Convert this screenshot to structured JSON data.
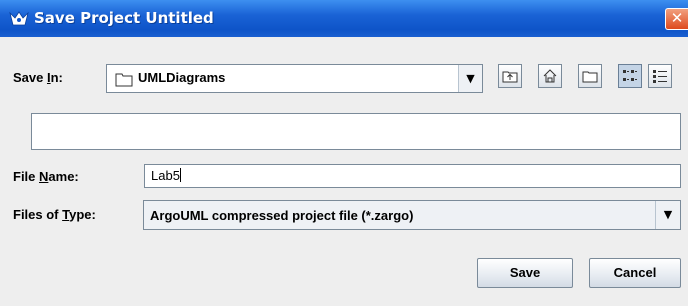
{
  "window": {
    "title": "Save Project Untitled",
    "close_glyph": "✕"
  },
  "save_in": {
    "label_pre": "Save ",
    "label_key": "I",
    "label_post": "n:",
    "value": "UMLDiagrams",
    "icon": "folder-icon"
  },
  "toolbar": {
    "buttons": [
      {
        "name": "up-one-level-button",
        "icon": "up-folder-icon"
      },
      {
        "name": "home-button",
        "icon": "home-icon"
      },
      {
        "name": "new-folder-button",
        "icon": "new-folder-icon"
      },
      {
        "name": "list-view-button",
        "icon": "list-view-icon",
        "active": true
      },
      {
        "name": "details-view-button",
        "icon": "details-view-icon"
      }
    ]
  },
  "file_name": {
    "label_pre": "File ",
    "label_key": "N",
    "label_post": "ame:",
    "value": "Lab5"
  },
  "file_type": {
    "label_pre": "Files of ",
    "label_key": "T",
    "label_post": "ype:",
    "value": "ArgoUML compressed project file (*.zargo)"
  },
  "actions": {
    "save_label": "Save",
    "cancel_label": "Cancel"
  },
  "colors": {
    "titlebar": "#0e54c8",
    "accent": "#3d8ff0",
    "close": "#de4a1e"
  }
}
